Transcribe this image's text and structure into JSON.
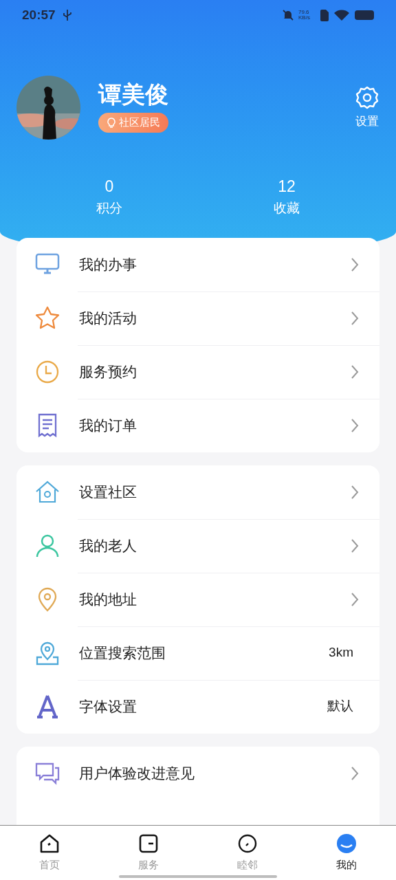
{
  "status_bar": {
    "time": "20:57",
    "speed": "79.6 KB/s"
  },
  "profile": {
    "name": "谭美俊",
    "badge": "社区居民",
    "settings_label": "设置"
  },
  "stats": [
    {
      "value": "0",
      "label": "积分"
    },
    {
      "value": "12",
      "label": "收藏"
    }
  ],
  "groups": [
    {
      "items": [
        {
          "label": "我的办事"
        },
        {
          "label": "我的活动"
        },
        {
          "label": "服务预约"
        },
        {
          "label": "我的订单"
        }
      ]
    },
    {
      "items": [
        {
          "label": "设置社区"
        },
        {
          "label": "我的老人"
        },
        {
          "label": "我的地址"
        },
        {
          "label": "位置搜索范围",
          "value": "3km"
        },
        {
          "label": "字体设置",
          "value": "默认"
        }
      ]
    },
    {
      "items": [
        {
          "label": "用户体验改进意见"
        }
      ]
    }
  ],
  "tabs": [
    {
      "label": "首页",
      "selected": false
    },
    {
      "label": "服务",
      "selected": false
    },
    {
      "label": "睦邻",
      "selected": false
    },
    {
      "label": "我的",
      "selected": true
    }
  ]
}
